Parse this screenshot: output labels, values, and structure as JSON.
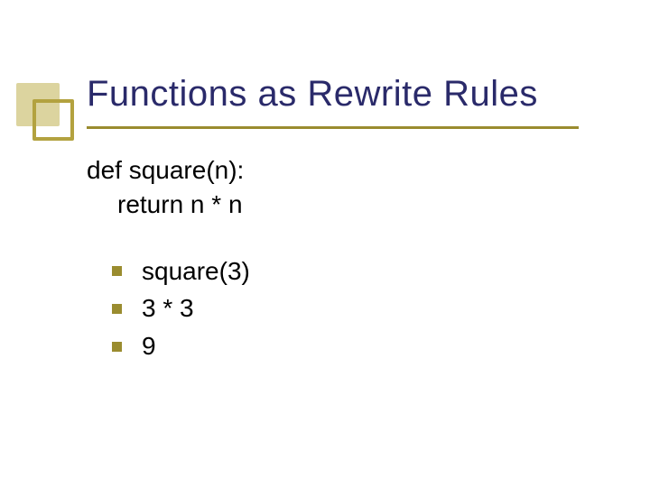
{
  "title": "Functions as Rewrite Rules",
  "code": {
    "line1": "def square(n):",
    "line2": "return n * n"
  },
  "evaluation": {
    "items": [
      "square(3)",
      "3 * 3",
      "9"
    ]
  }
}
